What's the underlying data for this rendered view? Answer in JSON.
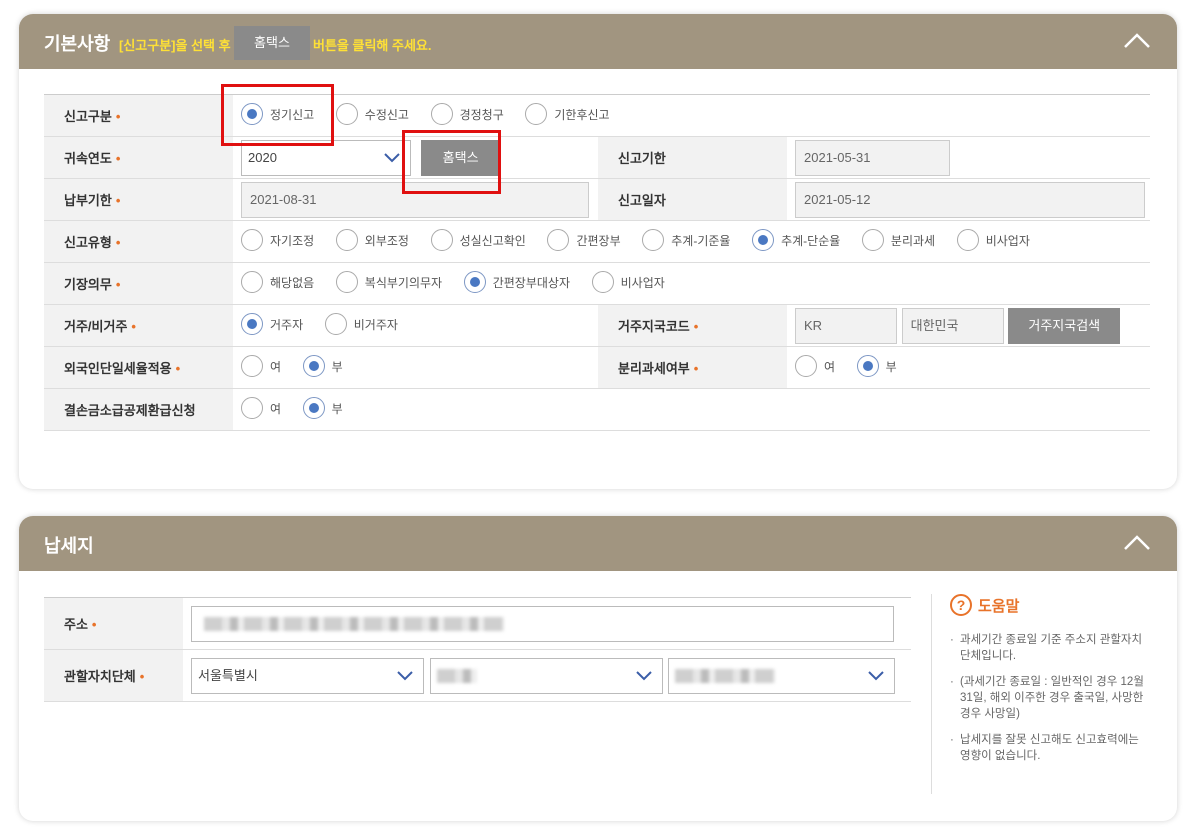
{
  "section_basic": {
    "title": "기본사항",
    "note_prefix": "[신고구분]을 선택 후",
    "note_button": "홈택스",
    "note_suffix": "버튼을 클릭해 주세요."
  },
  "fields": {
    "report_type": {
      "label": "신고구분",
      "options": [
        "정기신고",
        "수정신고",
        "경정청구",
        "기한후신고"
      ],
      "selected": "정기신고"
    },
    "year": {
      "label": "귀속연도",
      "value": "2020",
      "hometax_button": "홈택스"
    },
    "report_deadline": {
      "label": "신고기한",
      "value": "2021-05-31"
    },
    "pay_deadline": {
      "label": "납부기한",
      "value": "2021-08-31"
    },
    "report_date": {
      "label": "신고일자",
      "value": "2021-05-12"
    },
    "report_kind": {
      "label": "신고유형",
      "options": [
        "자기조정",
        "외부조정",
        "성실신고확인",
        "간편장부",
        "추계-기준율",
        "추계-단순율",
        "분리과세",
        "비사업자"
      ],
      "selected": "추계-단순율"
    },
    "bookkeeping": {
      "label": "기장의무",
      "options": [
        "해당없음",
        "복식부기의무자",
        "간편장부대상자",
        "비사업자"
      ],
      "selected": "간편장부대상자"
    },
    "residency": {
      "label": "거주/비거주",
      "options": [
        "거주자",
        "비거주자"
      ],
      "selected": "거주자"
    },
    "country_code": {
      "label": "거주지국코드",
      "code": "KR",
      "country": "대한민국",
      "search_button": "거주지국검색"
    },
    "foreign_flat_tax": {
      "label": "외국인단일세율적용",
      "options": [
        "여",
        "부"
      ],
      "selected": "부"
    },
    "separate_tax": {
      "label": "분리과세여부",
      "options": [
        "여",
        "부"
      ],
      "selected": "부"
    },
    "loss_refund": {
      "label": "결손금소급공제환급신청",
      "options": [
        "여",
        "부"
      ],
      "selected": "부"
    }
  },
  "section_taxpayer": {
    "title": "납세지",
    "address_label": "주소",
    "authority_label": "관할자치단체",
    "city_value": "서울특별시"
  },
  "help": {
    "title": "도움말",
    "icon": "question-icon",
    "items": [
      "과세기간 종료일 기준 주소지 관할자치단체입니다.",
      "(과세기간 종료일 : 일반적인 경우 12월31일, 해외 이주한 경우 출국일, 사망한 경우 사망일)",
      "납세지를 잘못 신고해도 신고효력에는 영향이 없습니다."
    ]
  },
  "colors": {
    "header": "#a19580",
    "accent": "#e8732a",
    "highlight_box": "#e01010",
    "radio_on": "#4a78c2",
    "note": "#ffe135"
  }
}
